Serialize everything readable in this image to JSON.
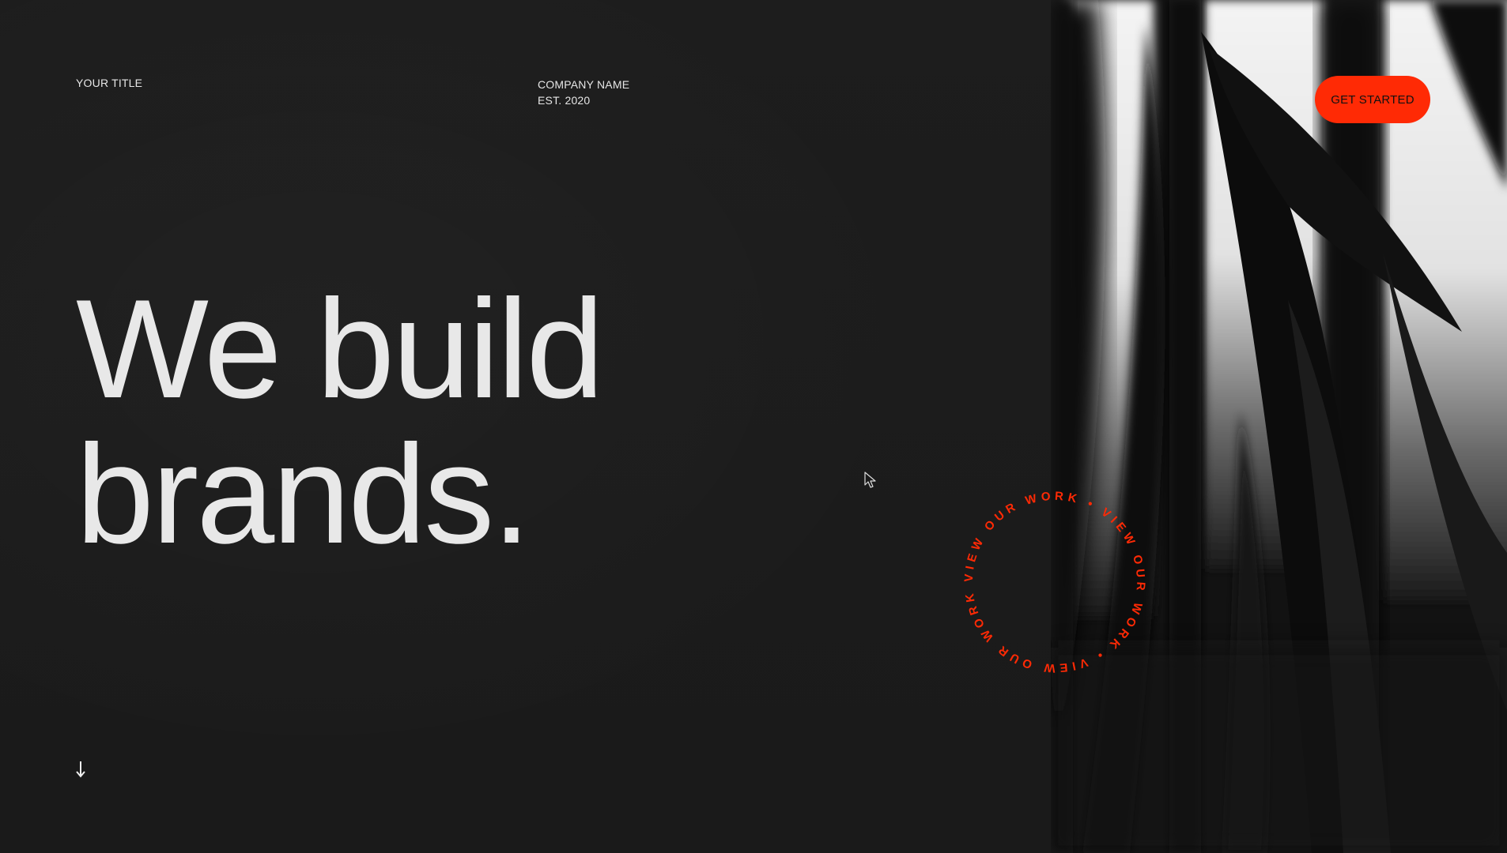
{
  "header": {
    "your_title": "YOUR TITLE",
    "company_name": "COMPANY NAME",
    "established": "EST. 2020",
    "cta_label": "GET STARTED"
  },
  "hero": {
    "line1": "We build",
    "line2": "brands."
  },
  "badge": {
    "text": "VIEW OUR WORK • VIEW OUR WORK • VIEW OUR WORK • "
  },
  "icons": {
    "scroll": "arrow-down-icon",
    "cursor": "mouse-pointer-icon"
  },
  "colors": {
    "background": "#1c1c1c",
    "text": "#e8e8e8",
    "accent": "#ff2a05"
  }
}
